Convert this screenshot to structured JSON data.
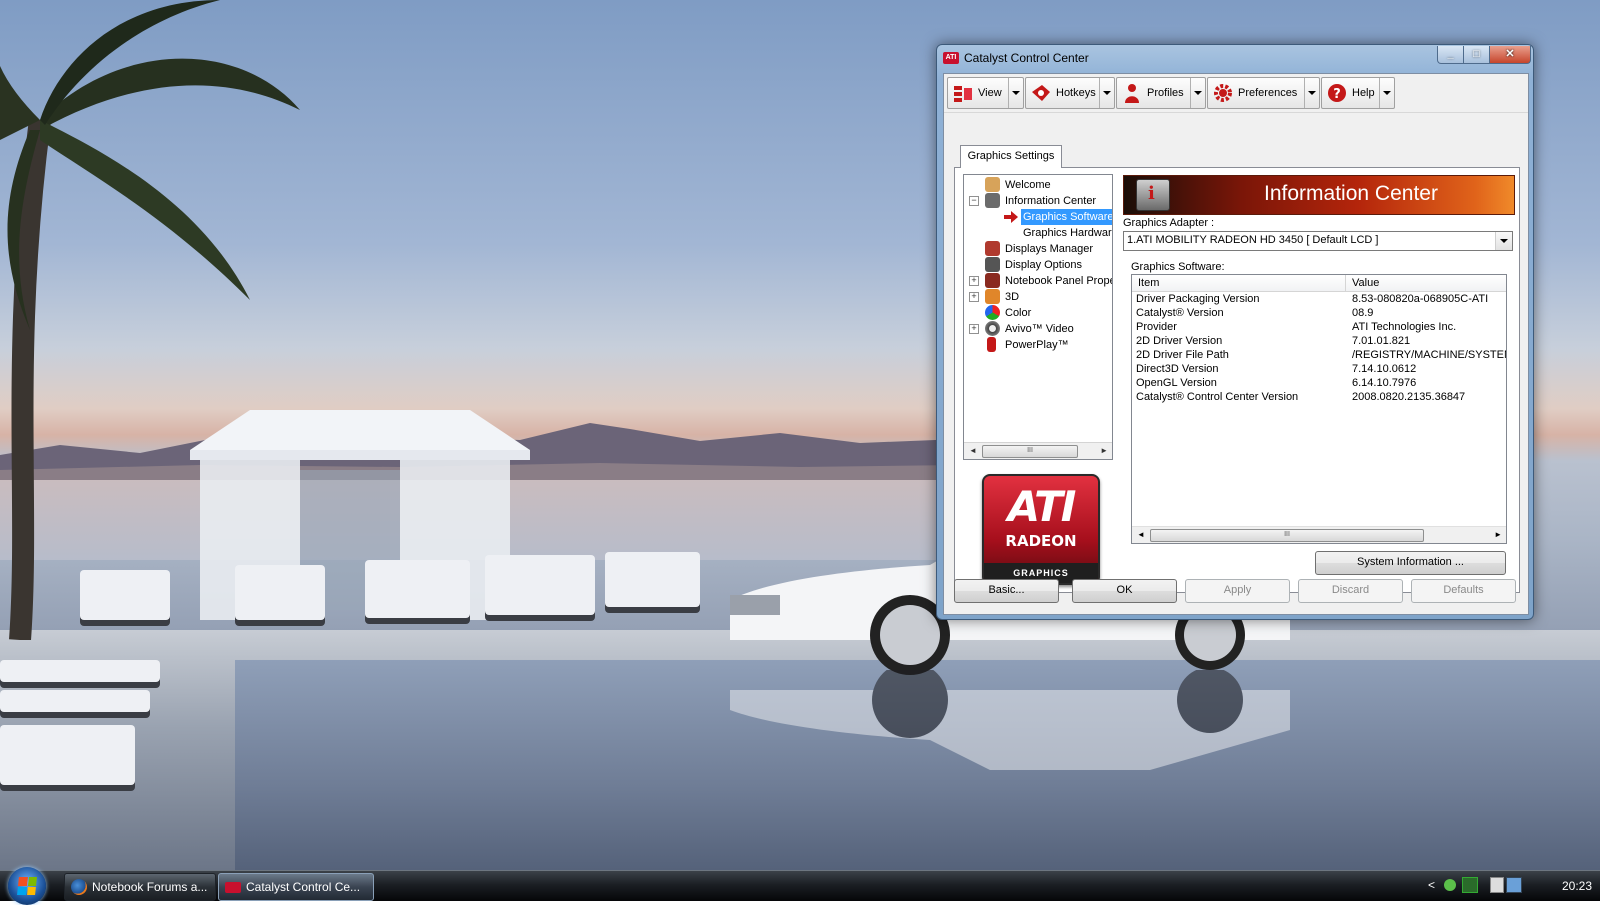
{
  "window": {
    "title": "Catalyst Control Center",
    "title_logo": "ATI"
  },
  "toolbar": {
    "buttons": [
      {
        "label": "View",
        "icon": "view-icon"
      },
      {
        "label": "Hotkeys",
        "icon": "hotkeys-icon"
      },
      {
        "label": "Profiles",
        "icon": "profiles-icon"
      },
      {
        "label": "Preferences",
        "icon": "preferences-icon"
      },
      {
        "label": "Help",
        "icon": "help-icon"
      }
    ]
  },
  "tab": {
    "label": "Graphics Settings"
  },
  "tree": {
    "items": [
      {
        "label": "Welcome",
        "icon": "welcome-hand-icon"
      },
      {
        "label": "Information Center",
        "icon": "information-center-icon",
        "expander": "−"
      },
      {
        "label": "Graphics Software",
        "icon": "selected-arrow-icon",
        "selected": true
      },
      {
        "label": "Graphics Hardware"
      },
      {
        "label": "Displays Manager",
        "icon": "displays-manager-icon"
      },
      {
        "label": "Display Options",
        "icon": "display-options-icon"
      },
      {
        "label": "Notebook Panel Proper",
        "icon": "notebook-panel-icon",
        "expander": "+"
      },
      {
        "label": "3D",
        "icon": "3d-icon",
        "expander": "+"
      },
      {
        "label": "Color",
        "icon": "color-icon"
      },
      {
        "label": "Avivo™ Video",
        "icon": "avivo-video-icon",
        "expander": "+"
      },
      {
        "label": "PowerPlay™",
        "icon": "powerplay-icon"
      }
    ],
    "scroll_thumb": "III"
  },
  "ati_logo": {
    "brand": "ATI",
    "line1": "RADEON",
    "line2": "GRAPHICS"
  },
  "info": {
    "banner_title": "Information Center",
    "adapter_label": "Graphics Adapter :",
    "adapter_value": "1.ATI MOBILITY RADEON HD 3450 [ Default LCD ]",
    "software_label": "Graphics Software:",
    "columns": [
      "Item",
      "Value"
    ],
    "rows": [
      [
        "Driver Packaging Version",
        "8.53-080820a-068905C-ATI"
      ],
      [
        "Catalyst® Version",
        "08.9"
      ],
      [
        "Provider",
        "ATI Technologies Inc."
      ],
      [
        "2D Driver Version",
        "7.01.01.821"
      ],
      [
        "2D Driver File Path",
        "/REGISTRY/MACHINE/SYSTEM"
      ],
      [
        "Direct3D Version",
        "7.14.10.0612"
      ],
      [
        "OpenGL Version",
        "6.14.10.7976"
      ],
      [
        "Catalyst® Control Center Version",
        "2008.0820.2135.36847"
      ]
    ],
    "scroll_thumb": "III",
    "system_info_button": "System Information ..."
  },
  "bottom_buttons": {
    "basic": "Basic...",
    "ok": "OK",
    "apply": "Apply",
    "discard": "Discard",
    "defaults": "Defaults"
  },
  "taskbar": {
    "tasks": [
      {
        "label": "Notebook Forums a...",
        "icon": "firefox-icon"
      },
      {
        "label": "Catalyst Control Ce...",
        "icon": "ati-icon",
        "active": true
      }
    ],
    "tray_expand": "<",
    "clock": "20:23"
  },
  "colors": {
    "selection": "#3399ff",
    "ati_red": "#c8102e",
    "banner_orange": "#e0631a"
  }
}
